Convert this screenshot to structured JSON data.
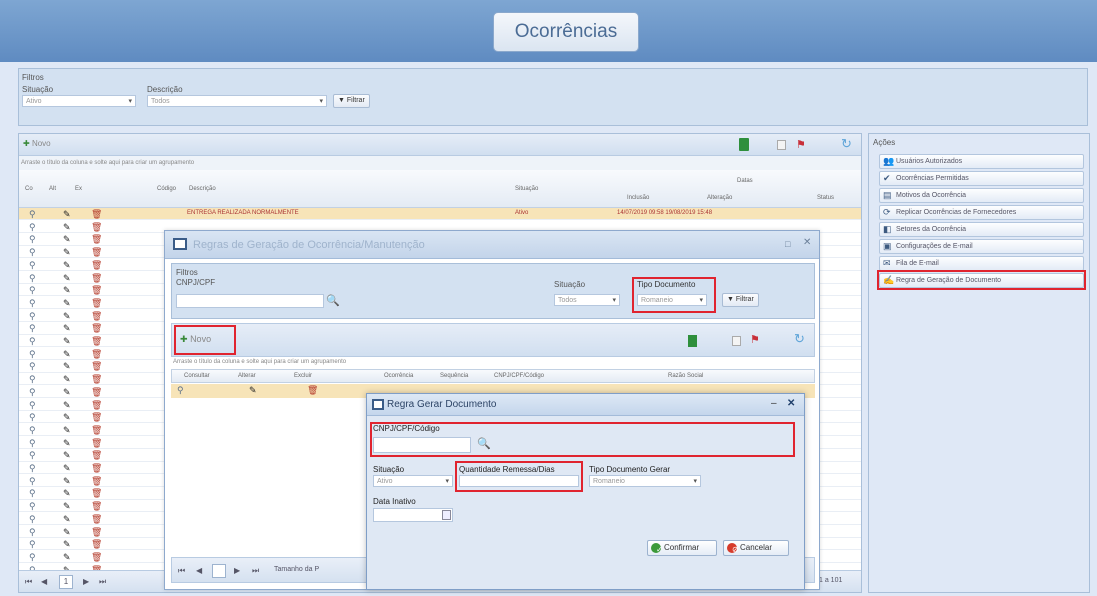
{
  "app": {
    "title": "Ocorrências"
  },
  "filters": {
    "title": "Filtros",
    "situacao_label": "Situação",
    "situacao_value": "Ativo",
    "descricao_label": "Descrição",
    "descricao_value": "Todos",
    "filter_button": "Filtrar"
  },
  "main": {
    "new_button": "Novo",
    "group_hint": "Arraste o título da coluna e solte aqui para criar um agrupamento",
    "columns": {
      "c1": "Co",
      "c2": "Alt",
      "c3": "Ex",
      "codigo": "Código",
      "descricao": "Descrição",
      "situacao": "Situação",
      "datas": "Datas",
      "inclusao": "Inclusão",
      "alteracao": "Alteração",
      "status": "Status"
    },
    "first_row": {
      "descricao": "ENTREGA REALIZADA NORMALMENTE",
      "situacao": "Ativo",
      "datas": "14/07/2019 09:58  19/08/2019 15:48"
    },
    "pager": {
      "page": "1",
      "right_text": "1 a 101"
    }
  },
  "actions": {
    "title": "Ações",
    "items": [
      {
        "label": "Usuários Autorizados",
        "icon": "users-icon"
      },
      {
        "label": "Ocorrências Permitidas",
        "icon": "check-icon"
      },
      {
        "label": "Motivos da Ocorrência",
        "icon": "list-icon"
      },
      {
        "label": "Replicar Ocorrências de Fornecedores",
        "icon": "refresh-icon"
      },
      {
        "label": "Setores da Ocorrência",
        "icon": "sectors-icon"
      },
      {
        "label": "Configurações de E-mail",
        "icon": "config-icon"
      },
      {
        "label": "Fila de E-mail",
        "icon": "mail-icon"
      },
      {
        "label": "Regra de Geração de Documento",
        "icon": "edit-icon"
      }
    ]
  },
  "modal1": {
    "title": "Regras de Geração de Ocorrência/Manutenção",
    "filter_title": "Filtros",
    "cnpj_label": "CNPJ/CPF",
    "situacao_label": "Situação",
    "situacao_value": "Todos",
    "tipo_label": "Tipo Documento",
    "tipo_value": "Romaneio",
    "filter_button": "Filtrar",
    "new_button": "Novo",
    "group_hint": "Arraste o título da coluna e solte aqui para criar um agrupamento",
    "columns": [
      "Consultar",
      "Alterar",
      "Excluir",
      "Ocorrência",
      "Sequência",
      "CNPJ/CPF/Código",
      "Razão Social"
    ],
    "pager_text": "Tamanho da P"
  },
  "modal2": {
    "title": "Regra Gerar Documento",
    "cnpj_label": "CNPJ/CPF/Código",
    "situacao_label": "Situação",
    "situacao_value": "Ativo",
    "quantidade_label": "Quantidade Remessa/Dias",
    "tipo_label": "Tipo Documento Gerar",
    "tipo_value": "Romaneio",
    "data_label": "Data Inativo",
    "confirm_button": "Confirmar",
    "cancel_button": "Cancelar"
  }
}
